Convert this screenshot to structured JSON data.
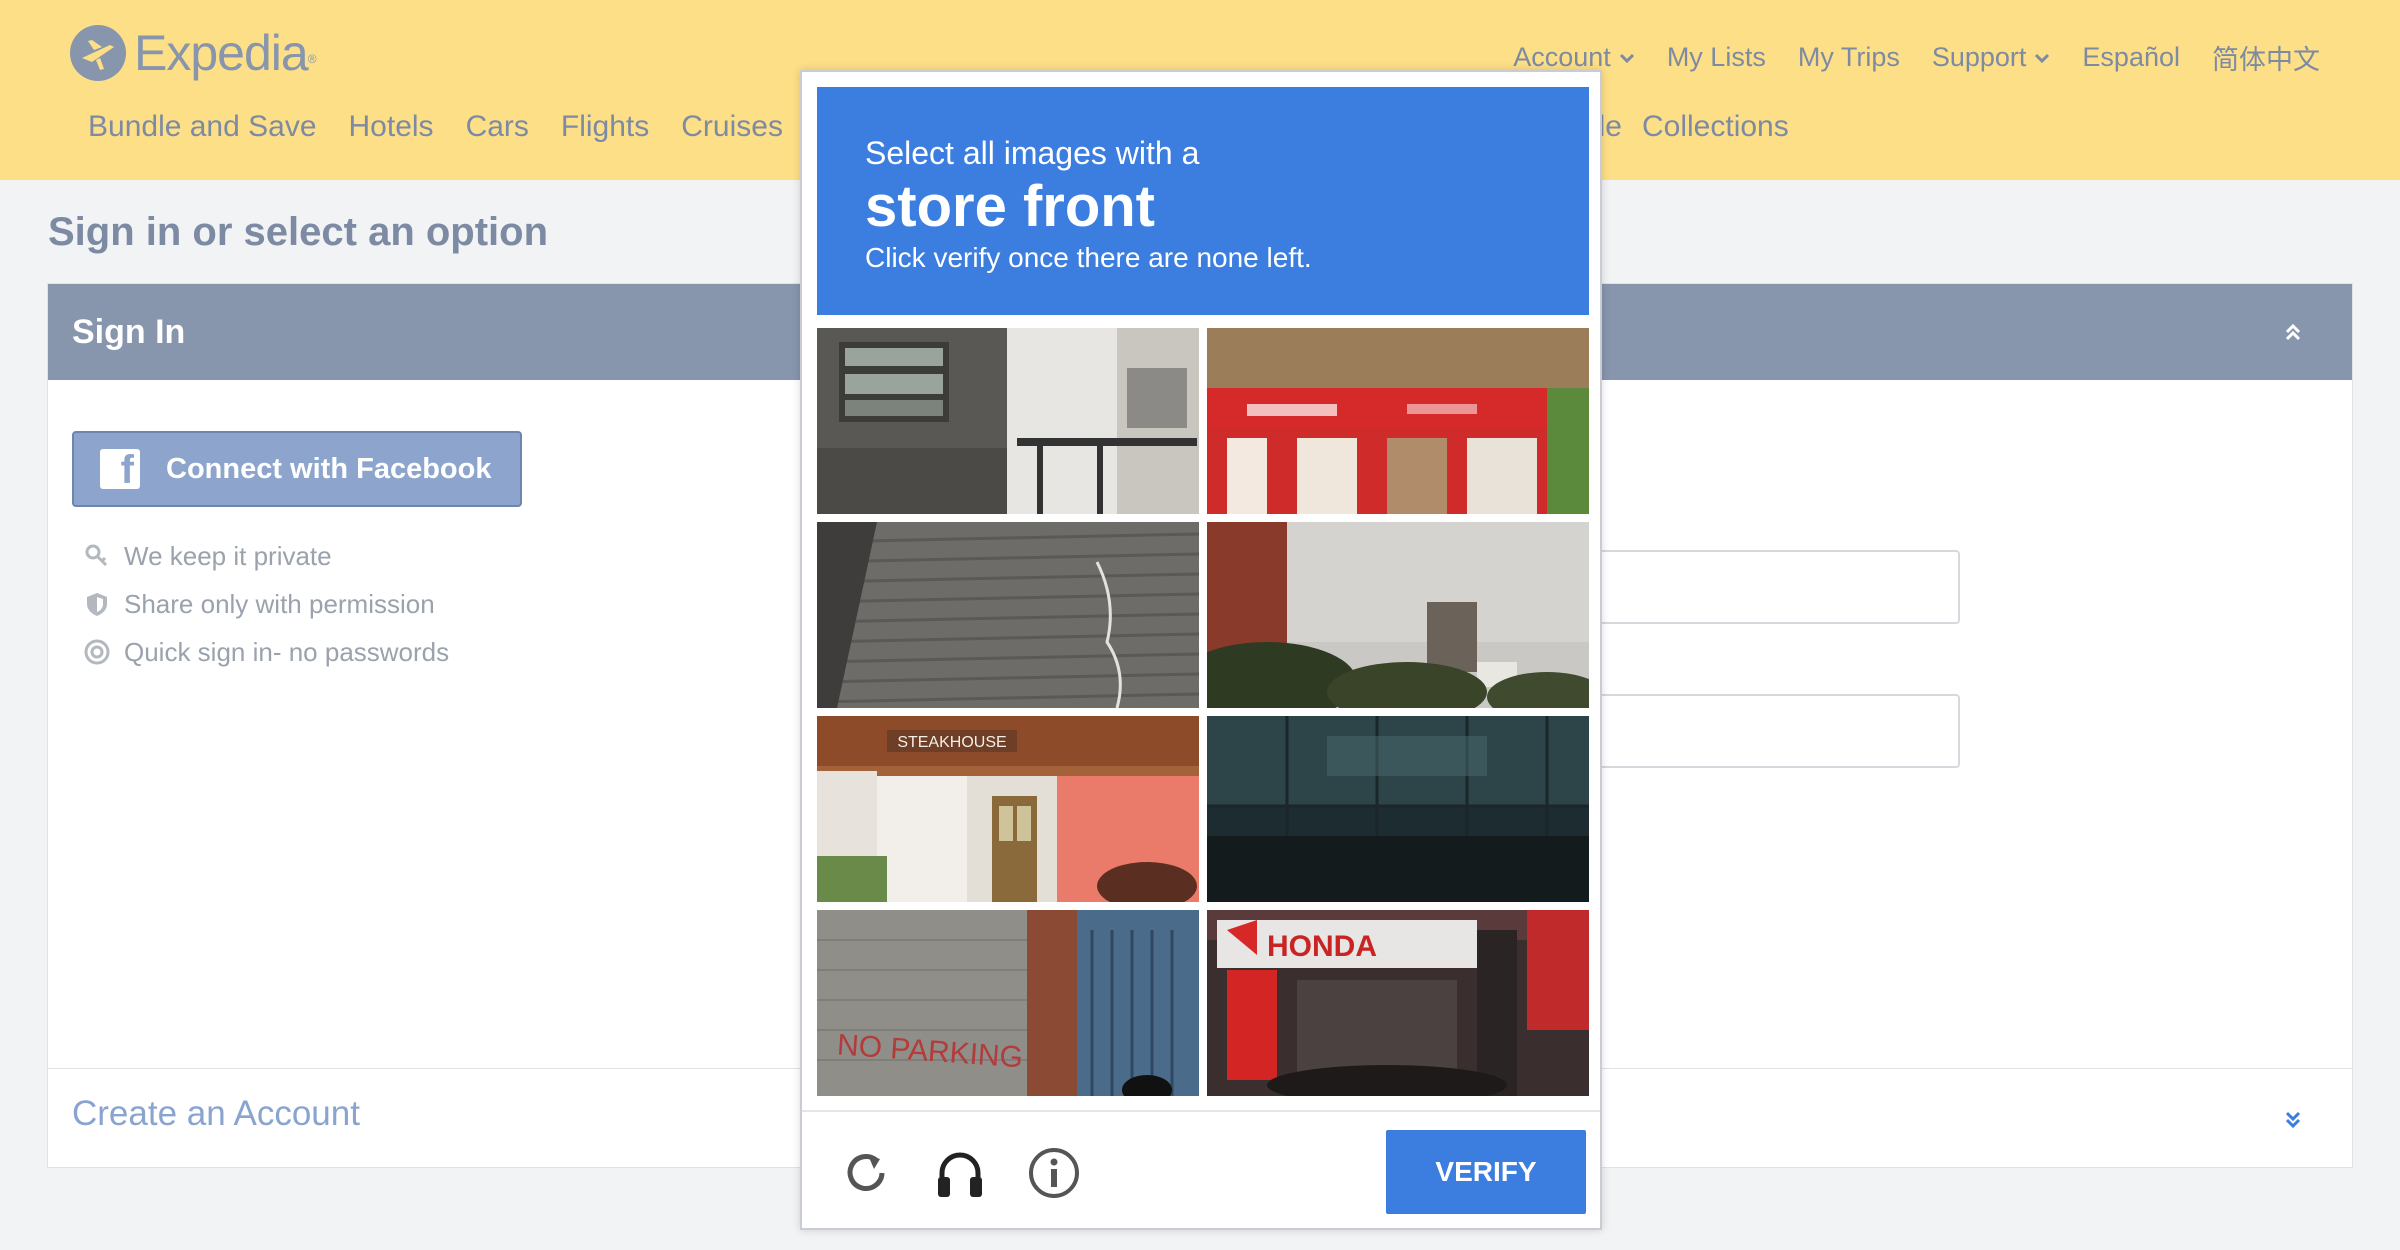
{
  "brand": {
    "logo_text": "Expedia",
    "logo_tm": "®"
  },
  "util_nav": {
    "account": "Account",
    "my_lists": "My Lists",
    "my_trips": "My Trips",
    "support": "Support",
    "espanol": "Español",
    "chinese": "简体中文"
  },
  "main_nav": {
    "bundle": "Bundle and Save",
    "hotels": "Hotels",
    "cars": "Cars",
    "flights": "Flights",
    "cruises": "Cruises",
    "partial": "le",
    "collections": "Collections"
  },
  "page_title": "Sign in or select an option",
  "signin_panel": {
    "heading": "Sign In",
    "facebook_label": "Connect with Facebook",
    "facebook_icon_letter": "f",
    "perks": [
      "We keep it private",
      "Share only with permission",
      "Quick sign in- no passwords"
    ],
    "create_account": "Create an Account"
  },
  "captcha": {
    "instruction_line1": "Select all images with a",
    "target": "store front",
    "instruction_line3": "Click verify once there are none left.",
    "tile_texts": {
      "steakhouse": "STEAKHOUSE",
      "no_parking": "NO PARKING",
      "honda": "HONDA"
    },
    "verify_label": "VERIFY",
    "icons": [
      "refresh-icon",
      "headphones-icon",
      "info-icon"
    ]
  },
  "colors": {
    "header_bg": "#fddf87",
    "nav_text": "#7d8aa3",
    "panel_head": "#8795ad",
    "captcha_blue": "#3b7ee0"
  }
}
